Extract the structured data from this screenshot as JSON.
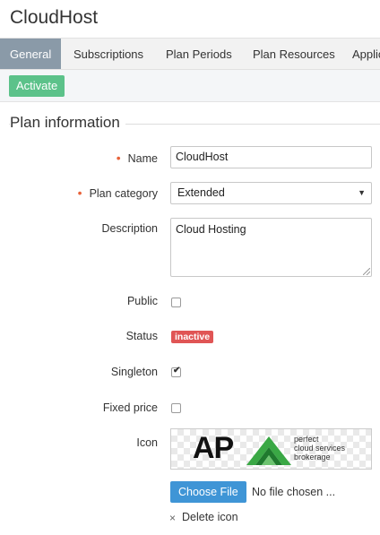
{
  "page": {
    "title": "CloudHost"
  },
  "tabs": [
    {
      "label": "General",
      "active": true
    },
    {
      "label": "Subscriptions"
    },
    {
      "label": "Plan Periods"
    },
    {
      "label": "Plan Resources"
    },
    {
      "label": "Applic"
    }
  ],
  "toolbar": {
    "activate_label": "Activate"
  },
  "section": {
    "title": "Plan information"
  },
  "form": {
    "name": {
      "label": "Name",
      "value": "CloudHost",
      "required": true
    },
    "plan_category": {
      "label": "Plan category",
      "value": "Extended",
      "required": true
    },
    "description": {
      "label": "Description",
      "value": "Cloud Hosting"
    },
    "public": {
      "label": "Public",
      "checked": false
    },
    "status": {
      "label": "Status",
      "value": "inactive"
    },
    "singleton": {
      "label": "Singleton",
      "checked": true
    },
    "fixed_price": {
      "label": "Fixed price",
      "checked": false
    },
    "icon": {
      "label": "Icon",
      "logo_text": "AP",
      "logo_tagline": [
        "perfect",
        "cloud services",
        "brokerage"
      ],
      "choose_file_label": "Choose File",
      "file_status": "No file chosen ...",
      "delete_label": "Delete icon",
      "delete_glyph": "×"
    }
  },
  "colors": {
    "active_tab": "#8a9aa8",
    "activate_button": "#5cc28a",
    "required_marker": "#e8623a",
    "status_badge": "#e05555",
    "file_button": "#3f95d6",
    "logo_green": "#3aa845"
  }
}
